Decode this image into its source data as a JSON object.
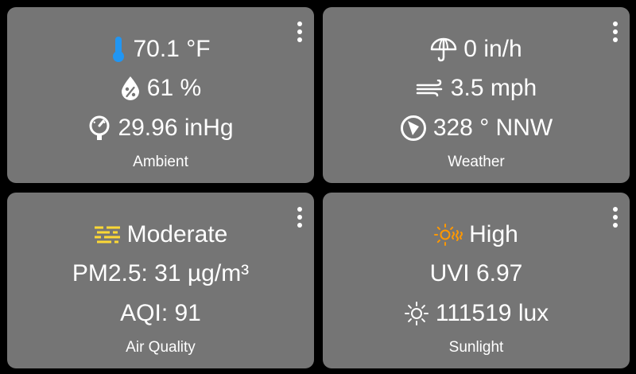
{
  "cards": {
    "ambient": {
      "title": "Ambient",
      "temperature": "70.1 °F",
      "humidity": "61 %",
      "pressure": "29.96 inHg",
      "icons": [
        "thermometer-icon",
        "water-percent-icon",
        "gauge-icon"
      ]
    },
    "weather": {
      "title": "Weather",
      "rain_rate": "0 in/h",
      "wind_speed": "3.5 mph",
      "wind_direction": "328 ° NNW",
      "icons": [
        "umbrella-icon",
        "wind-icon",
        "compass-icon"
      ]
    },
    "air_quality": {
      "title": "Air Quality",
      "level": "Moderate",
      "pm25": "PM2.5: 31 µg/m³",
      "aqi": "AQI: 91",
      "icons": [
        "haze-icon"
      ]
    },
    "sunlight": {
      "title": "Sunlight",
      "uv_level": "High",
      "uvi": "UVI 6.97",
      "illuminance": "111519 lux",
      "icons": [
        "hot-sun-icon",
        "sun-icon"
      ]
    }
  },
  "colors": {
    "background": "#000000",
    "card": "#757575",
    "text": "#ffffff",
    "thermometer": "#2196f3",
    "haze": "#fdd835",
    "uv": "#ff9800"
  }
}
